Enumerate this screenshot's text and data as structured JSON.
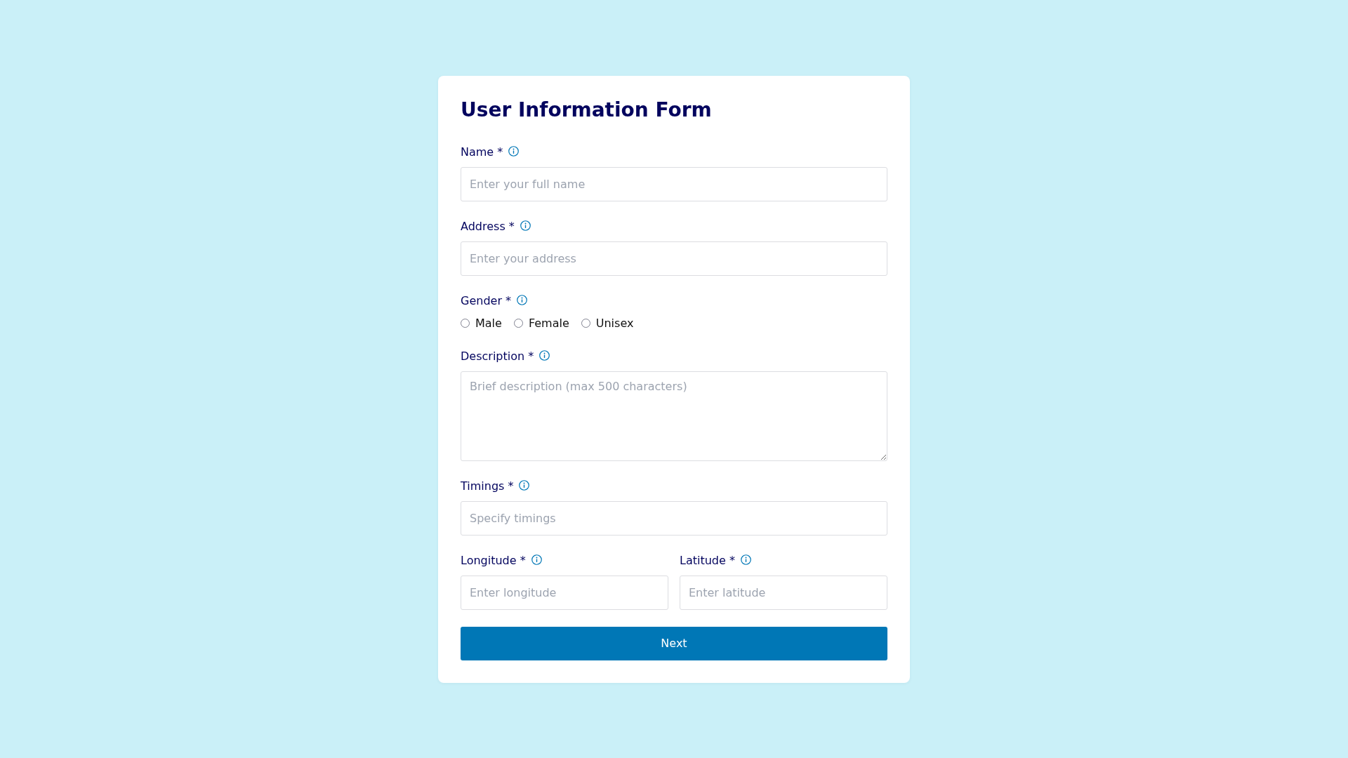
{
  "form": {
    "title": "User Information Form",
    "fields": [
      {
        "kind": "text",
        "label": "Name *",
        "placeholder": "Enter your full name"
      },
      {
        "kind": "text",
        "label": "Address *",
        "placeholder": "Enter your address"
      },
      {
        "kind": "radio",
        "label": "Gender *",
        "options": [
          {
            "label": "Male",
            "selected": false
          },
          {
            "label": "Female",
            "selected": false
          },
          {
            "label": "Unisex",
            "selected": false
          }
        ]
      },
      {
        "kind": "textarea",
        "label": "Description *",
        "placeholder": "Brief description (max 500 characters)"
      },
      {
        "kind": "text",
        "label": "Timings *",
        "placeholder": "Specify timings"
      },
      {
        "kind": "row",
        "fields": [
          {
            "kind": "text",
            "label": "Longitude *",
            "placeholder": "Enter longitude"
          },
          {
            "kind": "text",
            "label": "Latitude *",
            "placeholder": "Enter latitude"
          }
        ]
      }
    ],
    "submit_button": "Next"
  }
}
